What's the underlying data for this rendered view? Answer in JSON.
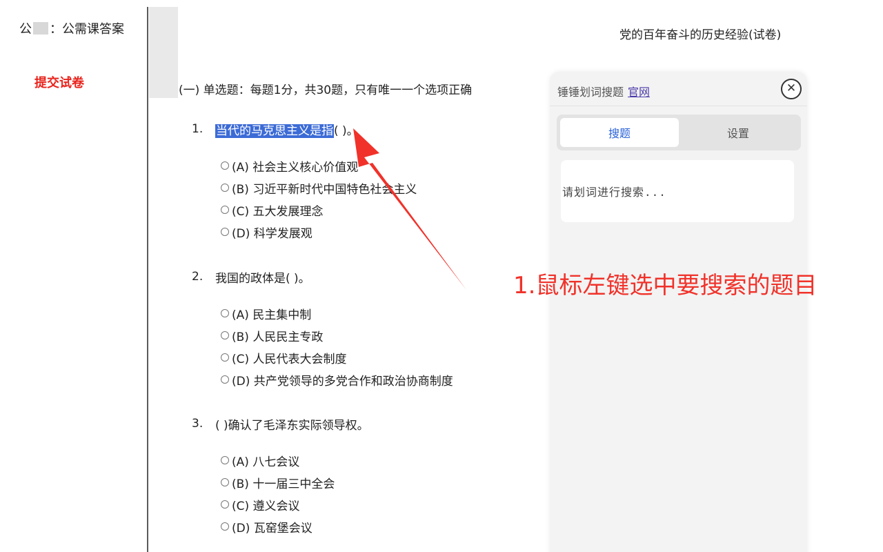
{
  "sidebar": {
    "account_prefix": "公",
    "account_suffix": "：公需课答案",
    "submit_label": "提交试卷"
  },
  "exam": {
    "title": "党的百年奋斗的历史经验(试卷)",
    "section_title": "(一) 单选题：每题1分，共30题，只有唯一一个选项正确",
    "questions": [
      {
        "number": "1.",
        "text_highlighted": "当代的马克思主义是指",
        "text_rest": "(  )。",
        "options": [
          "(A) 社会主义核心价值观",
          "(B) 习近平新时代中国特色社会主义",
          "(C) 五大发展理念",
          "(D) 科学发展观"
        ]
      },
      {
        "number": "2.",
        "text": "我国的政体是(  )。",
        "options": [
          "(A) 民主集中制",
          "(B) 人民民主专政",
          "(C) 人民代表大会制度",
          "(D) 共产党领导的多党合作和政治协商制度"
        ]
      },
      {
        "number": "3.",
        "text": "(  )确认了毛泽东实际领导权。",
        "options": [
          "(A) 八七会议",
          "(B) 十一届三中全会",
          "(C) 遵义会议",
          "(D) 瓦窑堡会议"
        ]
      }
    ]
  },
  "panel": {
    "title": "锤锤划词搜题",
    "link_label": "官网",
    "close_symbol": "✕",
    "tabs": [
      {
        "label": "搜题",
        "active": true
      },
      {
        "label": "设置",
        "active": false
      }
    ],
    "search_placeholder": "请划词进行搜索..."
  },
  "annotation": {
    "text": "1.鼠标左键选中要搜索的题目",
    "color": "#f0322a"
  },
  "colors": {
    "highlight": "#3c6bd6",
    "submit": "#e8231c",
    "active_tab": "#2a62d8"
  }
}
